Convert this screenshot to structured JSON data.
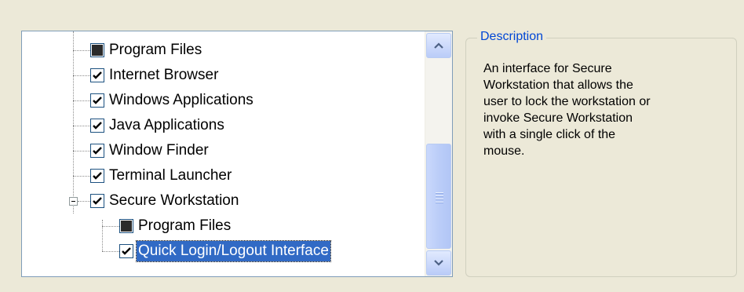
{
  "tree": {
    "items": [
      {
        "label": "Program Files",
        "state": "partial"
      },
      {
        "label": "Internet Browser",
        "state": "checked"
      },
      {
        "label": "Windows Applications",
        "state": "checked"
      },
      {
        "label": "Java Applications",
        "state": "checked"
      },
      {
        "label": "Window Finder",
        "state": "checked"
      },
      {
        "label": "Terminal Launcher",
        "state": "checked"
      },
      {
        "label": "Secure Workstation",
        "state": "checked",
        "expanded": true
      },
      {
        "label": "Program Files",
        "state": "partial"
      },
      {
        "label": "Quick Login/Logout Interface",
        "state": "checked",
        "selected": true
      }
    ]
  },
  "description": {
    "legend": "Description",
    "lines": [
      "An interface for Secure",
      "Workstation that allows the",
      "user to lock the workstation or",
      "invoke Secure Workstation",
      "with a single click of the",
      "mouse."
    ]
  },
  "colors": {
    "selection": "#316AC5",
    "legend_text": "#0046D5",
    "dialog_bg": "#ECE9D8"
  }
}
